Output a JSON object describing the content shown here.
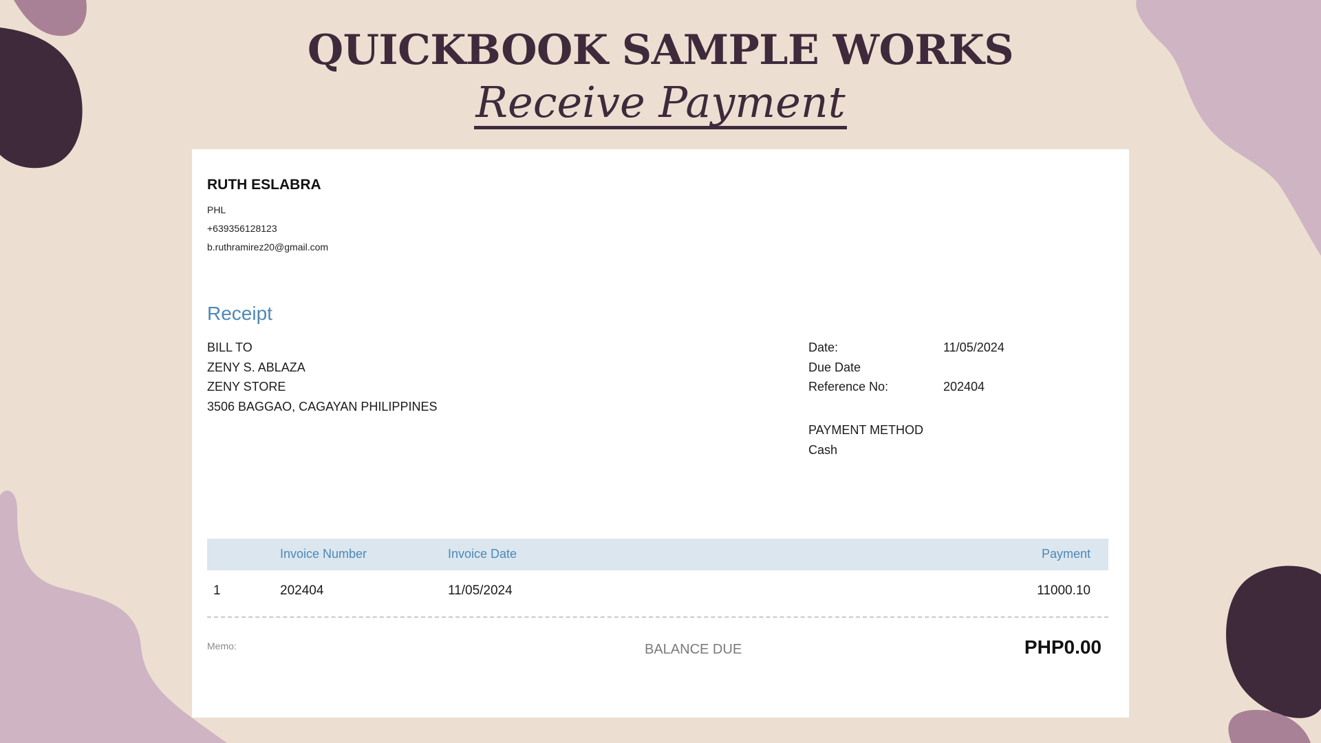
{
  "page": {
    "title": "QUICKBOOK SAMPLE WORKS",
    "subtitle": "Receive Payment"
  },
  "colors": {
    "background": "#ecdfd1",
    "dark_blob": "#3e2a3b",
    "light_blob": "#cfb4c3",
    "accent_blue": "#4e88b6",
    "table_header_bg": "#dbe6ef"
  },
  "company": {
    "name": "RUTH ESLABRA",
    "country": "PHL",
    "phone": "+639356128123",
    "email": "b.ruthramirez20@gmail.com"
  },
  "document_type": "Receipt",
  "bill_to": {
    "label": "BILL TO",
    "name": "ZENY S. ABLAZA",
    "store": "ZENY STORE",
    "address": "3506 BAGGAO, CAGAYAN PHILIPPINES"
  },
  "details": {
    "date_label": "Date:",
    "date_value": "11/05/2024",
    "due_date_label": "Due Date",
    "reference_label": "Reference No:",
    "reference_value": "202404",
    "payment_method_label": "PAYMENT METHOD",
    "payment_method_value": "Cash"
  },
  "table": {
    "headers": [
      "Invoice Number",
      "Invoice Date",
      "Payment"
    ],
    "rows": [
      {
        "index": "1",
        "invoice_number": "202404",
        "invoice_date": "11/05/2024",
        "payment": "11000.10"
      }
    ]
  },
  "footer": {
    "memo_label": "Memo:",
    "balance_label": "BALANCE DUE",
    "balance_value": "PHP0.00"
  }
}
